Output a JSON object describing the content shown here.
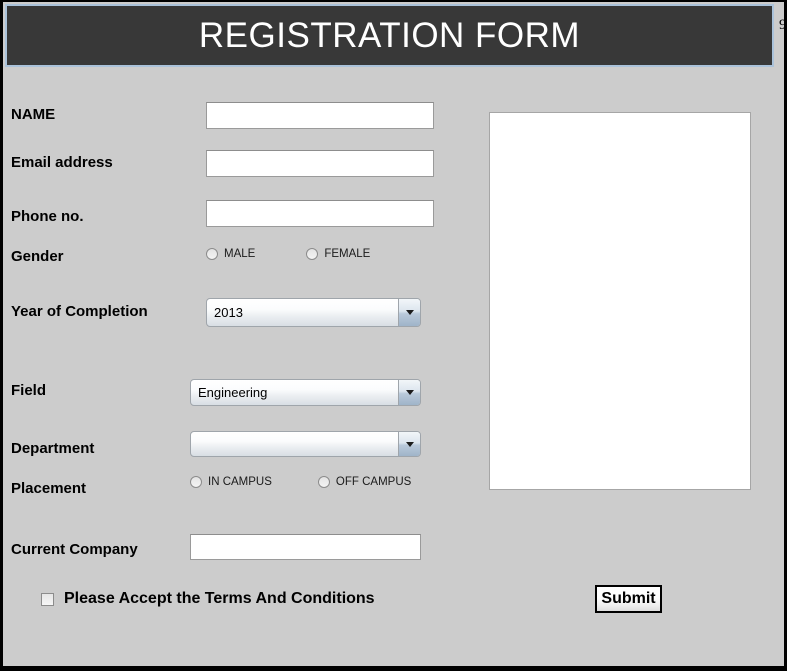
{
  "window": {
    "title": "REGISTRATION FORM",
    "edge_glyph": "9",
    "background_color": "#cccccc",
    "title_bar_color": "#383838",
    "title_text_color": "#ffffff",
    "title_border_color": "#aac2da"
  },
  "form": {
    "fields": {
      "name": {
        "label": "NAME",
        "value": "",
        "placeholder": ""
      },
      "email": {
        "label": "Email address",
        "value": "",
        "placeholder": ""
      },
      "phone": {
        "label": "Phone no.",
        "value": "",
        "placeholder": ""
      },
      "gender": {
        "label": "Gender",
        "options": [
          "MALE",
          "FEMALE"
        ],
        "selected": ""
      },
      "year_of_completion": {
        "label": "Year of Completion",
        "value": "2013"
      },
      "field": {
        "label": "Field",
        "value": "Engineering"
      },
      "department": {
        "label": "Department",
        "value": ""
      },
      "placement": {
        "label": "Placement",
        "options": [
          "IN CAMPUS",
          "OFF CAMPUS"
        ],
        "selected": ""
      },
      "current_company": {
        "label": "Current Company",
        "value": "",
        "placeholder": ""
      },
      "terms": {
        "label": "Please Accept the Terms And Conditions",
        "checked": false
      }
    },
    "submit": {
      "label": "Submit"
    },
    "photo_panel": {
      "content": ""
    }
  }
}
